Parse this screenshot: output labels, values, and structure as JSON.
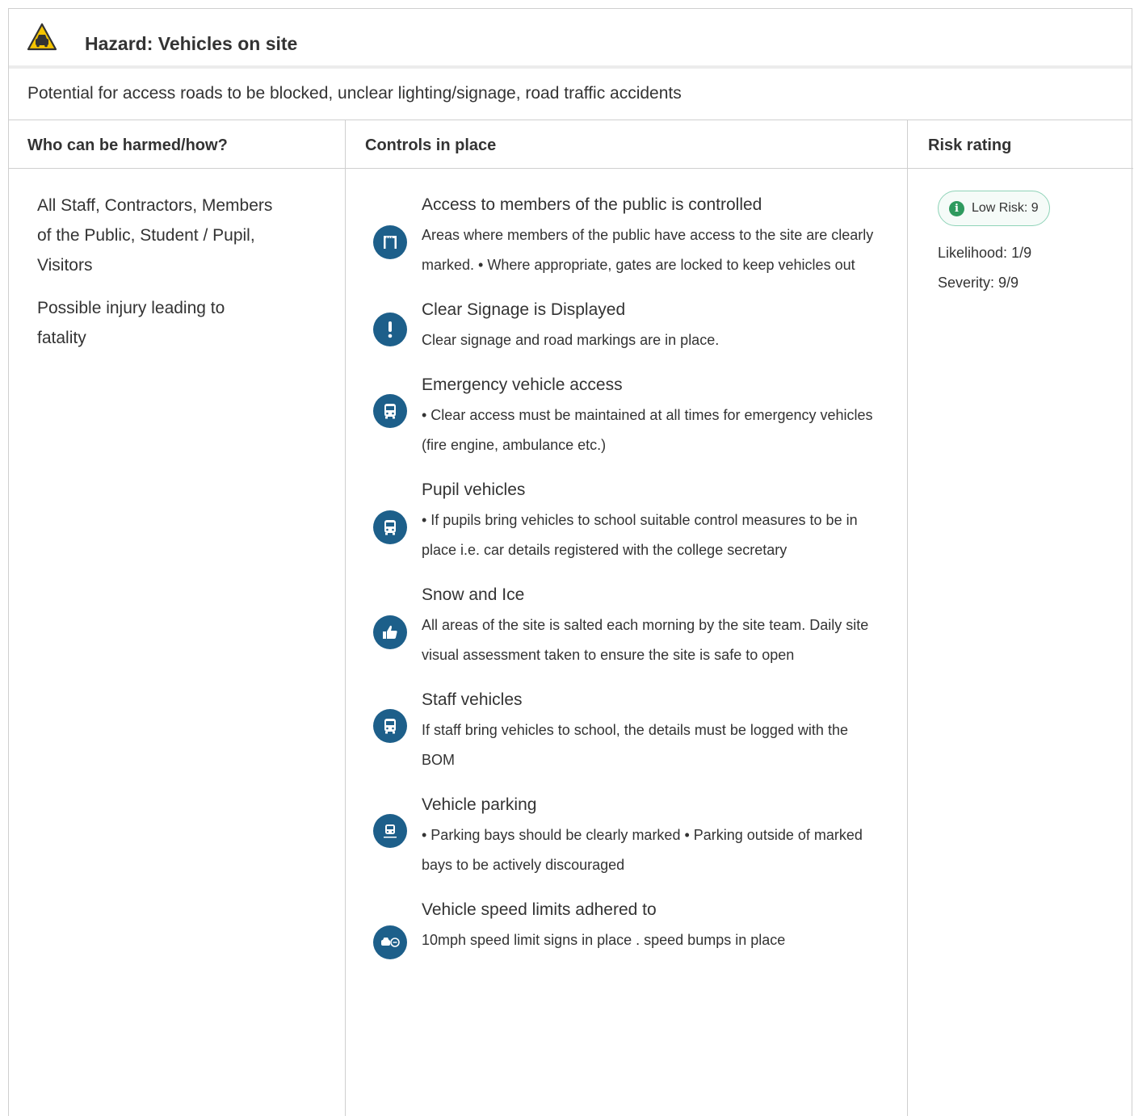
{
  "hazard": {
    "title": "Hazard:  Vehicles on site",
    "description": "Potential for access roads to be blocked, unclear lighting/signage, road traffic accidents",
    "icon": "vehicle-warning-icon",
    "icon_color": "#f5c400"
  },
  "columns": {
    "who": "Who can be harmed/how?",
    "controls": "Controls in place",
    "risk": "Risk rating"
  },
  "who": {
    "people": "All Staff, Contractors, Members of the Public, Student / Pupil, Visitors",
    "harm": "Possible injury leading to fatality"
  },
  "controls": [
    {
      "icon": "gate-icon",
      "title": "Access to members of the public is controlled",
      "desc": "Areas where members of the public have access to the site are clearly marked. • Where appropriate, gates are locked to keep vehicles out"
    },
    {
      "icon": "exclamation-icon",
      "title": "Clear Signage is Displayed",
      "desc": "Clear signage and road markings are in place."
    },
    {
      "icon": "bus-icon",
      "title": "Emergency vehicle access",
      "desc": "• Clear access must be maintained at all times for emergency vehicles (fire engine, ambulance etc.)"
    },
    {
      "icon": "bus-icon",
      "title": "Pupil vehicles",
      "desc": "• If pupils bring vehicles to school suitable control measures to be in place i.e. car details registered with the college secretary"
    },
    {
      "icon": "thumbs-up-icon",
      "title": "Snow and Ice",
      "desc": "All areas of the site is salted each morning by the site team. Daily site visual assessment taken to ensure the site is safe to open"
    },
    {
      "icon": "bus-icon",
      "title": "Staff vehicles",
      "desc": "If staff bring vehicles to school, the details must be logged with the BOM"
    },
    {
      "icon": "parking-icon",
      "title": "Vehicle parking",
      "desc": "• Parking bays should be clearly marked • Parking outside of marked bays to be actively discouraged"
    },
    {
      "icon": "speed-limit-icon",
      "title": "Vehicle speed limits adhered to",
      "desc": "10mph speed limit signs in place . speed bumps in place"
    }
  ],
  "risk": {
    "badge": "Low Risk: 9",
    "likelihood": "Likelihood: 1/9",
    "severity": "Severity: 9/9",
    "badge_color": "#2e9a5e"
  },
  "colors": {
    "icon_bg": "#1d5f8a",
    "border": "#cfcfcf"
  }
}
